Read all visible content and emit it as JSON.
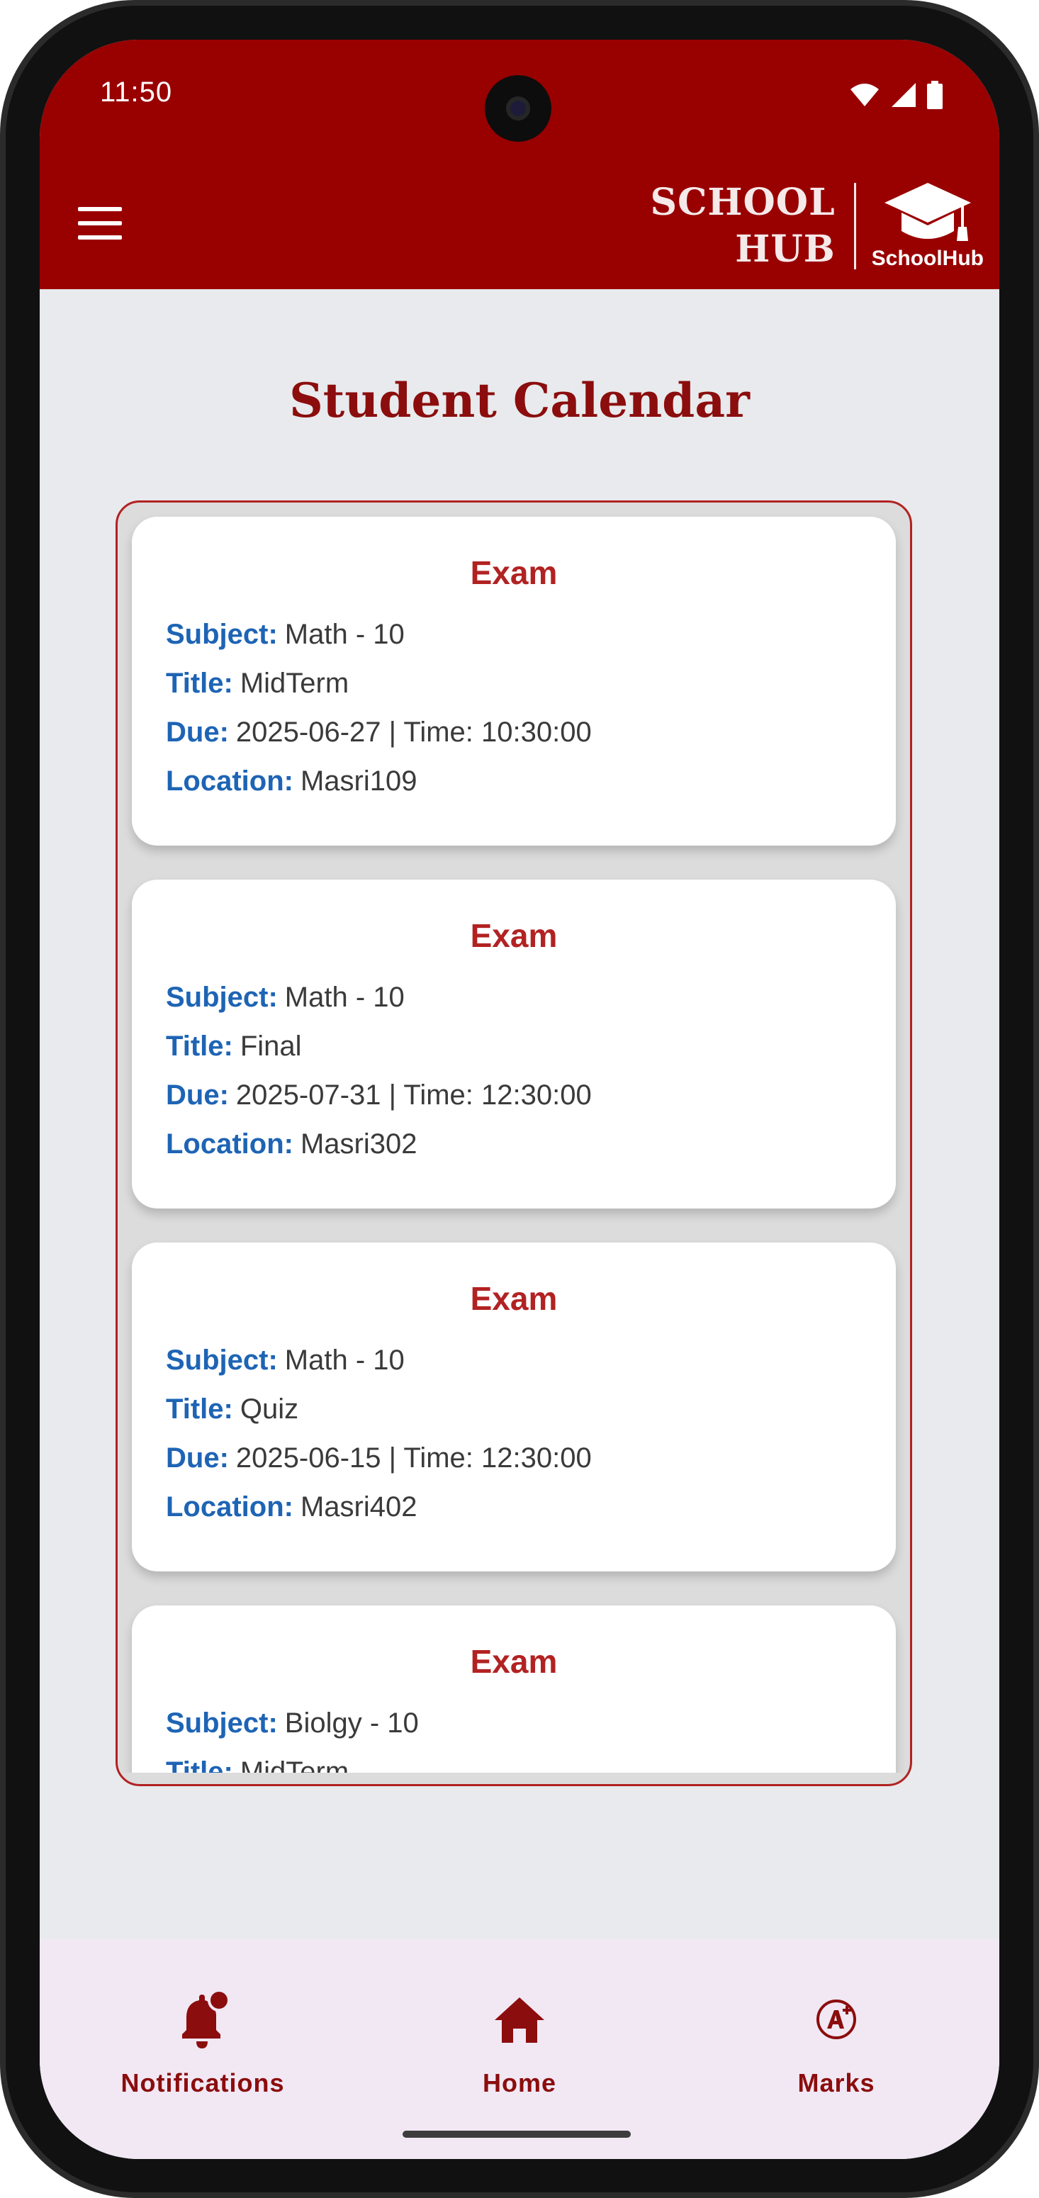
{
  "status_bar": {
    "time": "11:50",
    "icons": [
      "wifi-icon",
      "cellular-signal-icon",
      "battery-icon"
    ]
  },
  "header": {
    "menu_icon": "hamburger-menu-icon",
    "logo_line1": "SCHOOL",
    "logo_line2": "HUB",
    "logo_icon": "graduation-cap-icon",
    "logo_label": "SchoolHub"
  },
  "page": {
    "title": "Student Calendar"
  },
  "events": [
    {
      "type": "Exam",
      "subject_label": "Subject:",
      "subject": "Math - 10",
      "title_label": "Title:",
      "title": "MidTerm",
      "due_label": "Due:",
      "due": "2025-06-27 | Time: 10:30:00",
      "location_label": "Location:",
      "location": "Masri109"
    },
    {
      "type": "Exam",
      "subject_label": "Subject:",
      "subject": "Math - 10",
      "title_label": "Title:",
      "title": "Final",
      "due_label": "Due:",
      "due": "2025-07-31 | Time: 12:30:00",
      "location_label": "Location:",
      "location": "Masri302"
    },
    {
      "type": "Exam",
      "subject_label": "Subject:",
      "subject": "Math - 10",
      "title_label": "Title:",
      "title": "Quiz",
      "due_label": "Due:",
      "due": "2025-06-15 | Time: 12:30:00",
      "location_label": "Location:",
      "location": "Masri402"
    },
    {
      "type": "Exam",
      "subject_label": "Subject:",
      "subject": "Biolgy - 10",
      "title_label": "Title:",
      "title": "MidTerm"
    }
  ],
  "bottom_nav": [
    {
      "label": "Notifications",
      "icon": "notification-bell-badge-icon"
    },
    {
      "label": "Home",
      "icon": "home-icon"
    },
    {
      "label": "Marks",
      "icon": "grade-a-plus-icon"
    }
  ],
  "colors": {
    "brand": "#990000",
    "title": "#8b0d0d",
    "card_heading": "#b22222",
    "field_key": "#1e64b5",
    "background": "#e8eaed",
    "nav_background": "#f1e8f4"
  }
}
